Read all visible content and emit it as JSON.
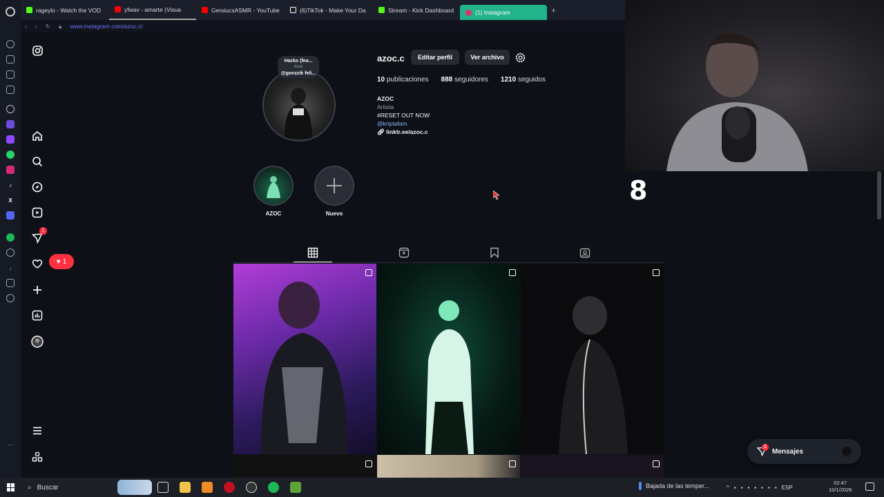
{
  "browser": {
    "tabs": [
      {
        "label": "rageylo - Watch the VOD",
        "color": "#53fc18"
      },
      {
        "label": "yfwav - amarte (Visua",
        "color": "#ff0000"
      },
      {
        "label": "GersiucsASMR - YouTube",
        "color": "#ff0000"
      },
      {
        "label": "(6)TikTok - Make Your Da",
        "color": "#ffffff"
      },
      {
        "label": "Stream - Kick Dashboard",
        "color": "#53fc18"
      },
      {
        "label": "(1) Instagram",
        "color": "#e1306c"
      }
    ],
    "new_tab": "+",
    "url": "www.instagram.com/azoc.c/"
  },
  "instagram": {
    "profile": {
      "username": "azoc.c",
      "edit_button": "Editar perfil",
      "archive_button": "Ver archivo",
      "stats": {
        "posts_count": "10",
        "posts_label": "publicaciones",
        "followers_count": "888",
        "followers_label": "seguidores",
        "following_count": "1210",
        "following_label": "seguidos"
      },
      "bio": {
        "name": "AZOC",
        "category": "Artista",
        "line": "#RESET OUT NOW",
        "mention": "@kriptafam",
        "link": "linktr.ee/azoc.c"
      },
      "note": {
        "title": "Hacks (fea...",
        "artist": "Azoc",
        "handle": "@gonzzik feli..."
      }
    },
    "highlights": [
      {
        "label": "AZOC"
      },
      {
        "label": "Nuevo"
      }
    ],
    "notifications_badge": "1",
    "likes_badge": "1",
    "messages_label": "Mensajes",
    "messages_badge": "1"
  },
  "overlay": {
    "counter": "8"
  },
  "taskbar": {
    "search_label": "Buscar",
    "weather": "Bajada de las temper...",
    "lang": "ESP",
    "time": "02:47",
    "date": "10/1/2026"
  }
}
